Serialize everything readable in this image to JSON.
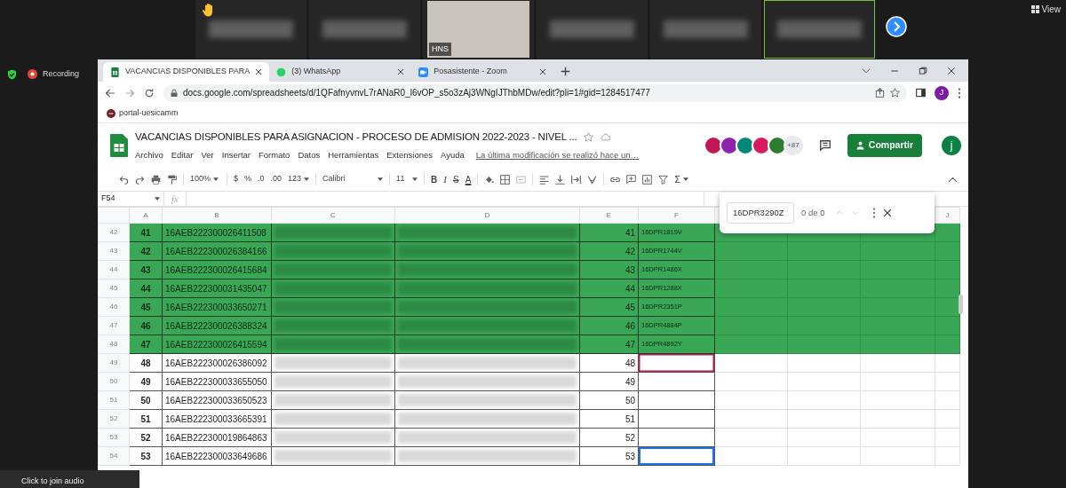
{
  "meeting": {
    "participants": [
      {
        "kind": "blurred",
        "hand_raised": true,
        "speaking": false
      },
      {
        "kind": "blurred",
        "hand_raised": false,
        "speaking": false
      },
      {
        "kind": "video",
        "name": "HNS",
        "hand_raised": false,
        "speaking": false
      },
      {
        "kind": "blurred",
        "hand_raised": false,
        "speaking": false
      },
      {
        "kind": "blurred",
        "hand_raised": false,
        "speaking": false
      },
      {
        "kind": "blurred",
        "hand_raised": false,
        "speaking": true
      }
    ],
    "view_button": "View",
    "recording": "Recording",
    "join_audio": "Click to join audio"
  },
  "browser": {
    "tabs": [
      {
        "kind": "spreadsheet",
        "title": "VACANCIAS DISPONIBLES PARA",
        "selected": true
      },
      {
        "kind": "messaging",
        "title": "(3) WhatsApp",
        "selected": false
      },
      {
        "kind": "meeting",
        "title": "Posasistente - Zoom",
        "selected": false
      }
    ],
    "url": "docs.google.com/spreadsheets/d/1QFafnyvnvL7rANaR0_l6vOP_s5o3zAj3WNgIJThbMDw/edit?pli=1#gid=1284517477",
    "profile": "J",
    "bookmark": "portal-uesicamm"
  },
  "sheet": {
    "title": "VACANCIAS DISPONIBLES PARA ASIGNACION - PROCESO DE ADMISION 2022-2023 - NIVEL ...",
    "menu": [
      "Archivo",
      "Editar",
      "Ver",
      "Insertar",
      "Formato",
      "Datos",
      "Herramientas",
      "Extensiones",
      "Ayuda"
    ],
    "last_edit": "La última modificación se realizó hace un…",
    "collaborators": [
      {
        "color": "#c2185b"
      },
      {
        "color": "#8e24aa"
      },
      {
        "color": "#00897b"
      },
      {
        "color": "#d81b60"
      },
      {
        "color": "#2e7d32"
      }
    ],
    "more_collaborators": "+87",
    "share_button": "Compartir",
    "user": "j",
    "toolbar": {
      "zoom": "100%",
      "currency": "$",
      "percent": "%",
      "decrease_decimals": ".0",
      "increase_decimals": ".00",
      "number_format": "123",
      "font": "Calibri",
      "font_size": "11",
      "bold": "B",
      "italic": "I",
      "strikethrough": "S",
      "text_color": "A",
      "functions": "Σ"
    },
    "cell_ref": "F54",
    "formula_label": "fx",
    "columns": [
      "A",
      "B",
      "C",
      "D",
      "E",
      "F",
      "J"
    ],
    "rows": [
      {
        "row": "42",
        "a": "41",
        "b": "16AEB222300026411508",
        "e": "41",
        "f": "16DPR1819V",
        "highlighted": true,
        "collaborator_cursor": false,
        "active_cell": false
      },
      {
        "row": "43",
        "a": "42",
        "b": "16AEB222300026384166",
        "e": "42",
        "f": "16DPR1744V",
        "highlighted": true,
        "collaborator_cursor": false,
        "active_cell": false
      },
      {
        "row": "44",
        "a": "43",
        "b": "16AEB222300026415684",
        "e": "43",
        "f": "16DPR1486X",
        "highlighted": true,
        "collaborator_cursor": false,
        "active_cell": false
      },
      {
        "row": "45",
        "a": "44",
        "b": "16AEB222300031435047",
        "e": "44",
        "f": "16DPR1288X",
        "highlighted": true,
        "collaborator_cursor": false,
        "active_cell": false
      },
      {
        "row": "46",
        "a": "45",
        "b": "16AEB222300033650271",
        "e": "45",
        "f": "16DPR2351P",
        "highlighted": true,
        "collaborator_cursor": false,
        "active_cell": false
      },
      {
        "row": "47",
        "a": "46",
        "b": "16AEB222300026388324",
        "e": "46",
        "f": "16DPR4884P",
        "highlighted": true,
        "collaborator_cursor": false,
        "active_cell": false
      },
      {
        "row": "48",
        "a": "47",
        "b": "16AEB222300026415594",
        "e": "47",
        "f": "16DPR4892Y",
        "highlighted": true,
        "collaborator_cursor": false,
        "active_cell": false
      },
      {
        "row": "49",
        "a": "48",
        "b": "16AEB222300026386092",
        "e": "48",
        "highlighted": false,
        "collaborator_cursor": true,
        "active_cell": false
      },
      {
        "row": "50",
        "a": "49",
        "b": "16AEB222300033655050",
        "e": "49",
        "highlighted": false,
        "collaborator_cursor": false,
        "active_cell": false
      },
      {
        "row": "51",
        "a": "50",
        "b": "16AEB222300033650523",
        "e": "50",
        "highlighted": false,
        "collaborator_cursor": false,
        "active_cell": false
      },
      {
        "row": "52",
        "a": "51",
        "b": "16AEB222300033665391",
        "e": "51",
        "highlighted": false,
        "collaborator_cursor": false,
        "active_cell": false
      },
      {
        "row": "53",
        "a": "52",
        "b": "16AEB222300019864863",
        "e": "52",
        "highlighted": false,
        "collaborator_cursor": false,
        "active_cell": false
      },
      {
        "row": "54",
        "a": "53",
        "b": "16AEB222300033649686",
        "e": "53",
        "highlighted": false,
        "collaborator_cursor": false,
        "active_cell": true
      }
    ],
    "find": {
      "value": "16DPR3290Z",
      "count": "0 de 0"
    }
  }
}
